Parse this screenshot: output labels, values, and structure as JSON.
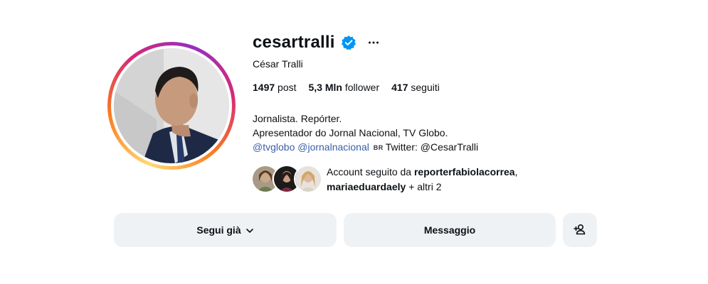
{
  "profile": {
    "username": "cesartralli",
    "full_name": "César Tralli",
    "verified": true,
    "stats": {
      "posts_count": "1497",
      "posts_label": "post",
      "followers_count": "5,3 Mln",
      "followers_label": "follower",
      "following_count": "417",
      "following_label": "seguiti"
    },
    "bio": {
      "line1": "Jornalista. Repórter.",
      "line2": "Apresentador do Jornal Nacional, TV Globo.",
      "mention1": "@tvglobo",
      "mention2": "@jornalnacional",
      "flag": "BR",
      "twitter": "Twitter: @CesarTralli"
    },
    "followed_by": {
      "prefix": "Account seguito da",
      "user1": "reporterfabiolacorrea",
      "separator": ",",
      "user2": "mariaeduardaely",
      "suffix": "+ altri 2"
    }
  },
  "actions": {
    "follow_label": "Segui già",
    "message_label": "Messaggio"
  },
  "icons": {
    "verified": "verified-badge-icon",
    "more": "more-options-icon",
    "chevron": "chevron-down-icon",
    "suggest": "add-person-icon"
  },
  "colors": {
    "link": "#3c5ea8",
    "verified": "#0095f6",
    "button_bg": "#eff2f5"
  }
}
